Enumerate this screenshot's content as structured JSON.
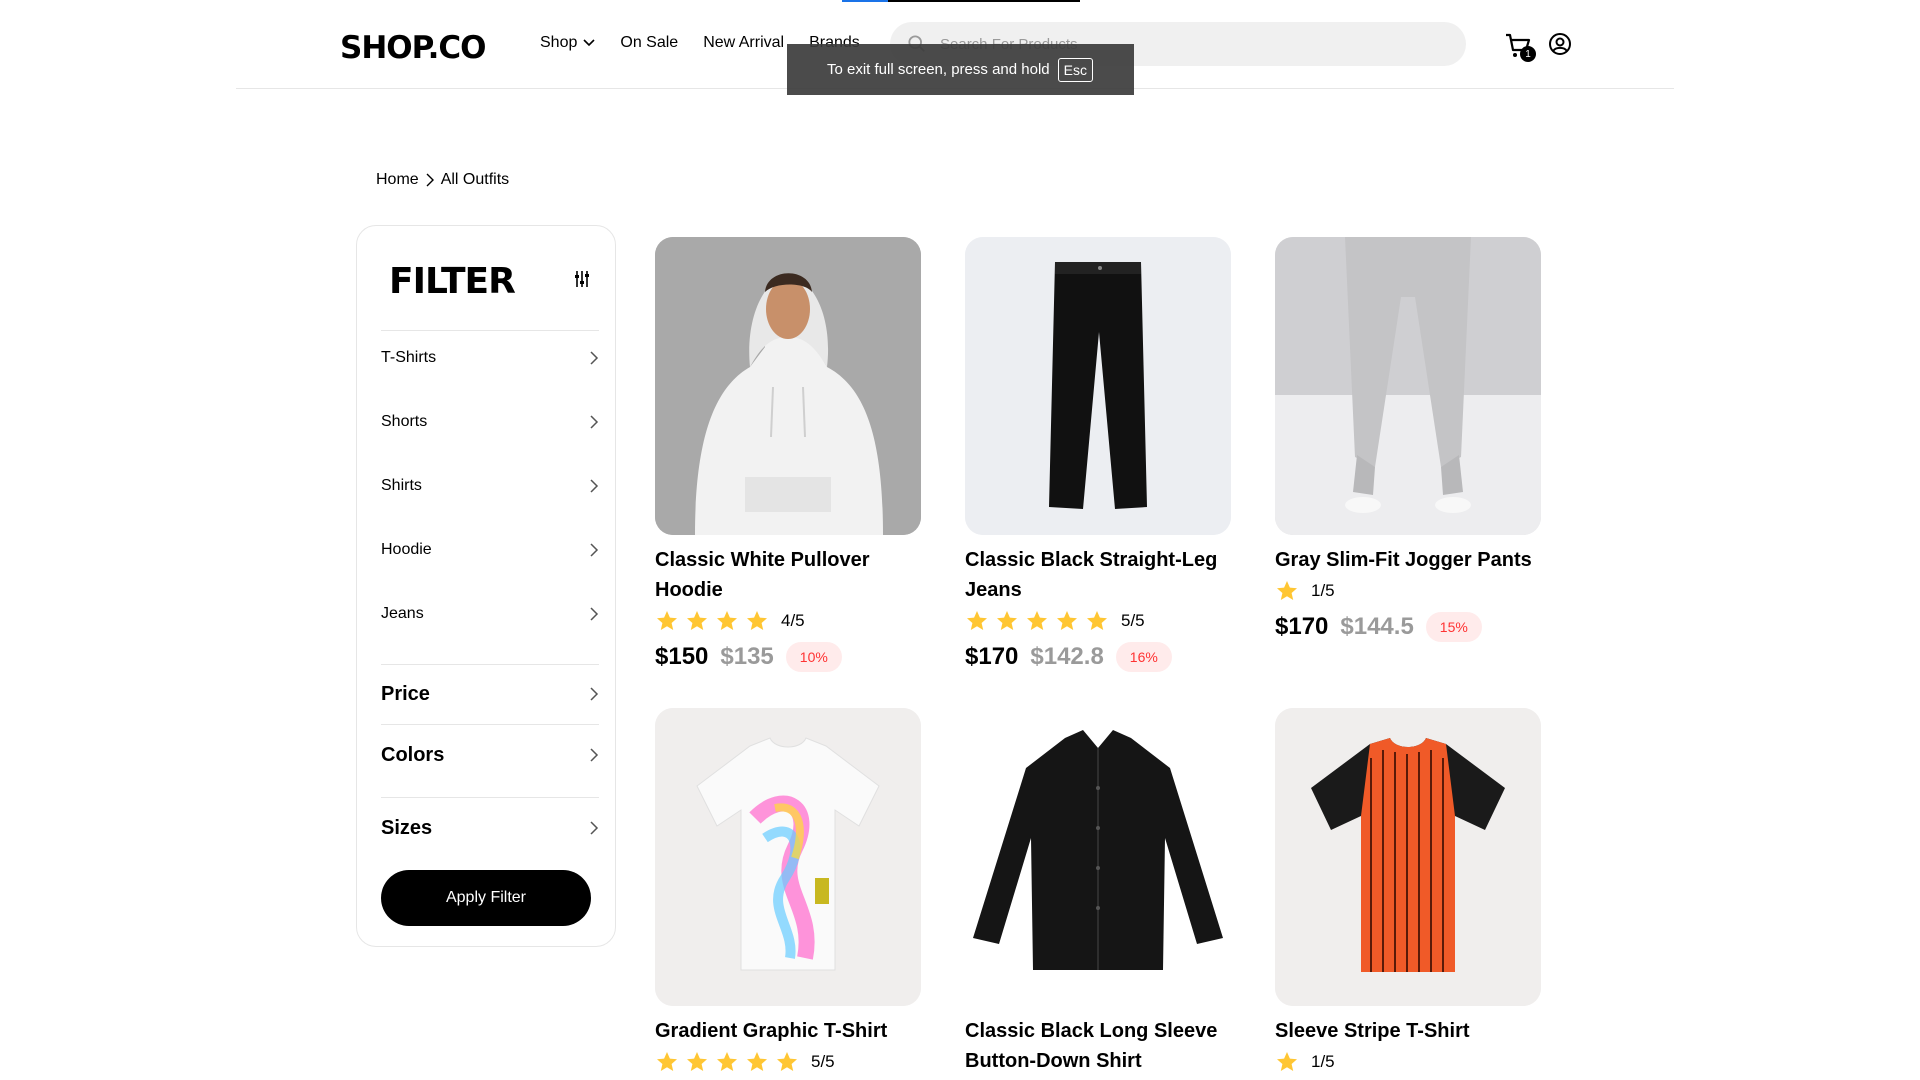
{
  "header": {
    "logo": "SHOP.CO",
    "nav": [
      {
        "label": "Shop",
        "has_dropdown": true
      },
      {
        "label": "On Sale"
      },
      {
        "label": "New Arrival"
      },
      {
        "label": "Brands"
      }
    ],
    "search_placeholder": "Search For Products",
    "cart_count": "1"
  },
  "toast": {
    "text": "To exit full screen, press and hold",
    "key": "Esc"
  },
  "breadcrumb": {
    "home": "Home",
    "current": "All Outfits"
  },
  "filter": {
    "title": "FILTER",
    "categories": [
      "T-Shirts",
      "Shorts",
      "Shirts",
      "Hoodie",
      "Jeans"
    ],
    "sections": [
      "Price",
      "Colors",
      "Sizes"
    ],
    "apply_label": "Apply Filter"
  },
  "products": [
    {
      "name": "Classic White Pullover Hoodie",
      "rating": 4,
      "rating_text": "4/5",
      "price": "$150",
      "old_price": "$135",
      "discount": "10%"
    },
    {
      "name": "Classic Black Straight-Leg Jeans",
      "rating": 5,
      "rating_text": "5/5",
      "price": "$170",
      "old_price": "$142.8",
      "discount": "16%"
    },
    {
      "name": "Gray Slim-Fit Jogger Pants",
      "rating": 1,
      "rating_text": "1/5",
      "price": "$170",
      "old_price": "$144.5",
      "discount": "15%"
    },
    {
      "name": "Gradient Graphic T-Shirt",
      "rating": 5,
      "rating_text": "5/5"
    },
    {
      "name": "Classic Black Long Sleeve Button-Down Shirt"
    },
    {
      "name": "Sleeve Stripe T-Shirt",
      "rating": 1,
      "rating_text": "1/5"
    }
  ],
  "colors": {
    "star": "#FFC633",
    "discount_text": "#FF3333",
    "discount_bg": "#FFEBEB",
    "accent": "#000000"
  }
}
